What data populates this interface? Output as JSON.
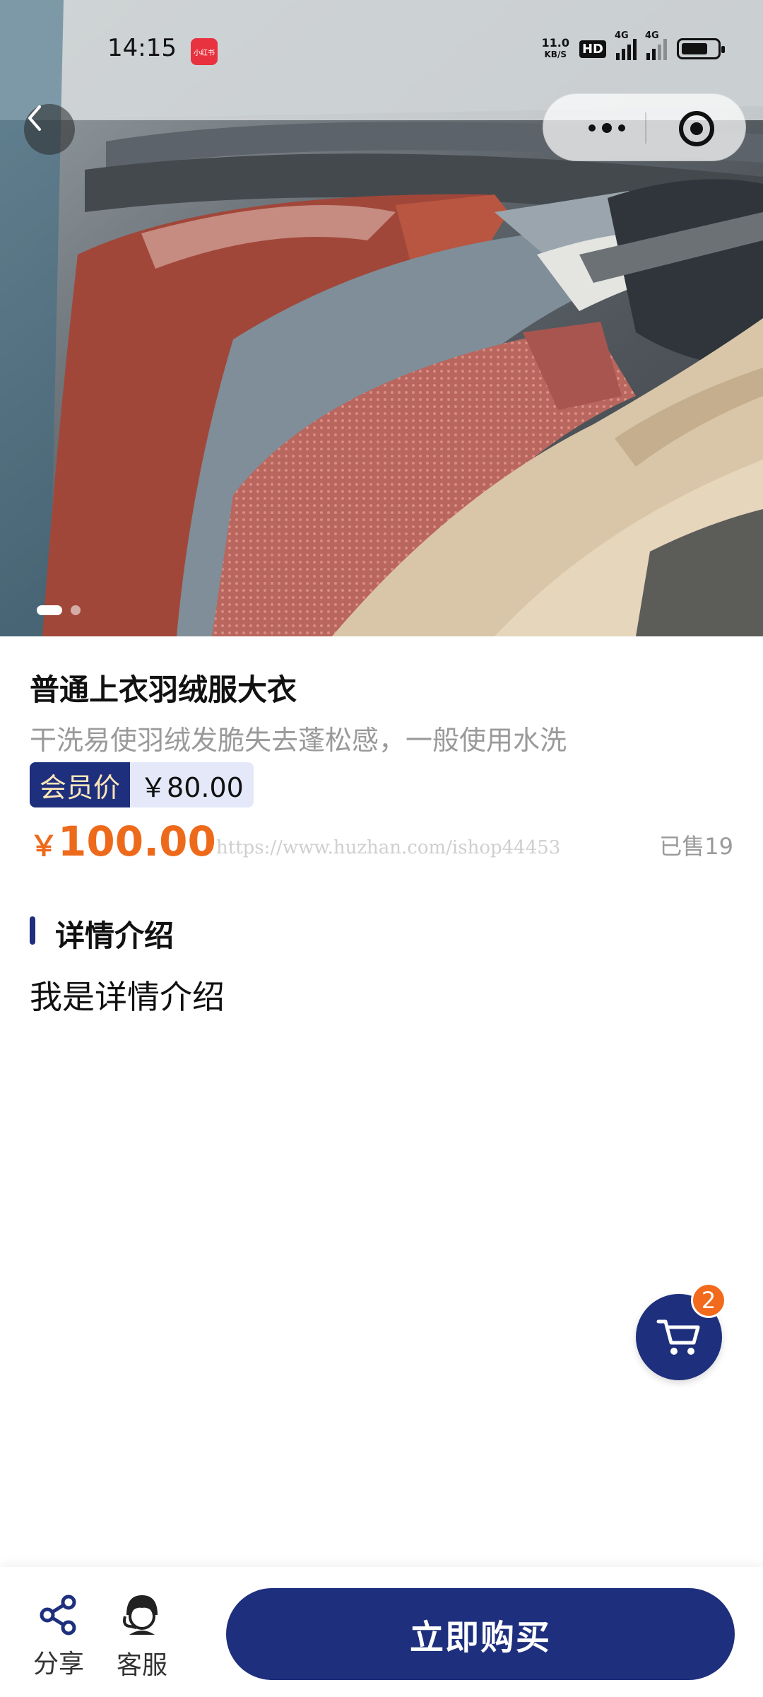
{
  "status_bar": {
    "time": "14:15",
    "app_badge": "小红书",
    "net_speed_value": "11.0",
    "net_speed_unit": "KB/S",
    "hd": "HD",
    "network": [
      "4G",
      "4G"
    ]
  },
  "product": {
    "title": "普通上衣羽绒服大衣",
    "subtitle": "干洗易使羽绒发脆失去蓬松感，一般使用水洗",
    "member_tag": "会员价",
    "member_price": "￥80.00",
    "currency": "￥",
    "price": "100.00",
    "sold": "已售19",
    "watermark": "https://www.huzhan.com/ishop44453"
  },
  "carousel": {
    "count": 2,
    "active": 0
  },
  "details": {
    "section_title": "详情介绍",
    "content": "我是详情介绍"
  },
  "cart": {
    "badge": "2"
  },
  "bottom_bar": {
    "share_label": "分享",
    "service_label": "客服",
    "buy_label": "立即购买"
  },
  "colors": {
    "primary": "#1e2f7d",
    "accent": "#ee6a1b",
    "member_tag_text": "#fde6b8"
  }
}
